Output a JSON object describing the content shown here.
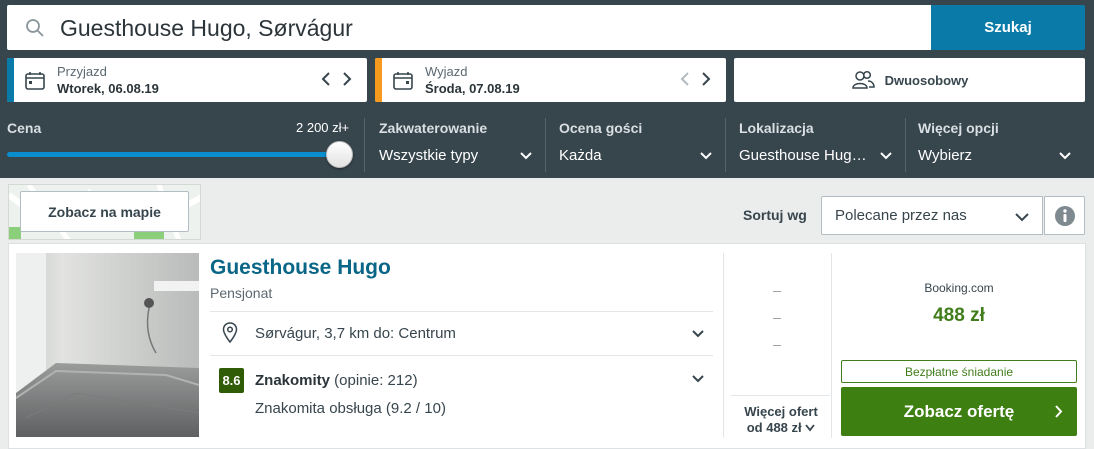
{
  "search": {
    "query": "Guesthouse Hugo, Sørvágur",
    "button_label": "Szukaj"
  },
  "dates": {
    "checkin": {
      "label": "Przyjazd",
      "value": "Wtorek, 06.08.19",
      "accent": "#0a7ba8"
    },
    "checkout": {
      "label": "Wyjazd",
      "value": "Środa, 07.08.19",
      "accent": "#f59a1e"
    }
  },
  "room": {
    "label": "Dwuosobowy"
  },
  "filters": {
    "price": {
      "title": "Cena",
      "max_label": "2 200 zł+"
    },
    "accommodation": {
      "title": "Zakwaterowanie",
      "value": "Wszystkie typy"
    },
    "rating": {
      "title": "Ocena gości",
      "value": "Każda"
    },
    "location": {
      "title": "Lokalizacja",
      "value": "Guesthouse Hug…"
    },
    "more": {
      "title": "Więcej opcji",
      "value": "Wybierz"
    }
  },
  "map": {
    "button_label": "Zobacz na mapie"
  },
  "sort": {
    "label": "Sortuj wg",
    "value": "Polecane przez nas"
  },
  "result": {
    "name": "Guesthouse Hugo",
    "type": "Pensjonat",
    "location": "Sørvágur, 3,7 km do: Centrum",
    "rating_score": "8.6",
    "rating_word": "Znakomity",
    "rating_count": " (opinie: 212)",
    "rating_detail": "Znakomita obsługa (9.2 / 10)",
    "more_offers_line1": "Więcej ofert",
    "more_offers_line2": "od 488 zł",
    "provider": "Booking.com",
    "price": "488 zł",
    "perk": "Bezpłatne śniadanie",
    "deal_button": "Zobacz ofertę"
  },
  "colors": {
    "header_bg": "#37454d",
    "brand_blue": "#0a7ba8",
    "deal_green": "#3d7f11",
    "rating_green": "#305c08"
  }
}
